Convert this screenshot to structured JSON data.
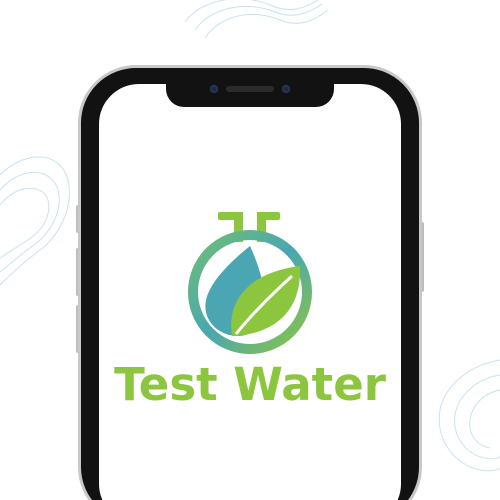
{
  "splash": {
    "app_name": "Test Water",
    "logo_icon": "flask-leaf-water-icon"
  },
  "colors": {
    "brand_green": "#8cc63f",
    "brand_teal": "#49a6b2",
    "background_lines": "#c7e3ee",
    "phone_body": "#121212",
    "phone_rim": "#c8c8c8"
  }
}
